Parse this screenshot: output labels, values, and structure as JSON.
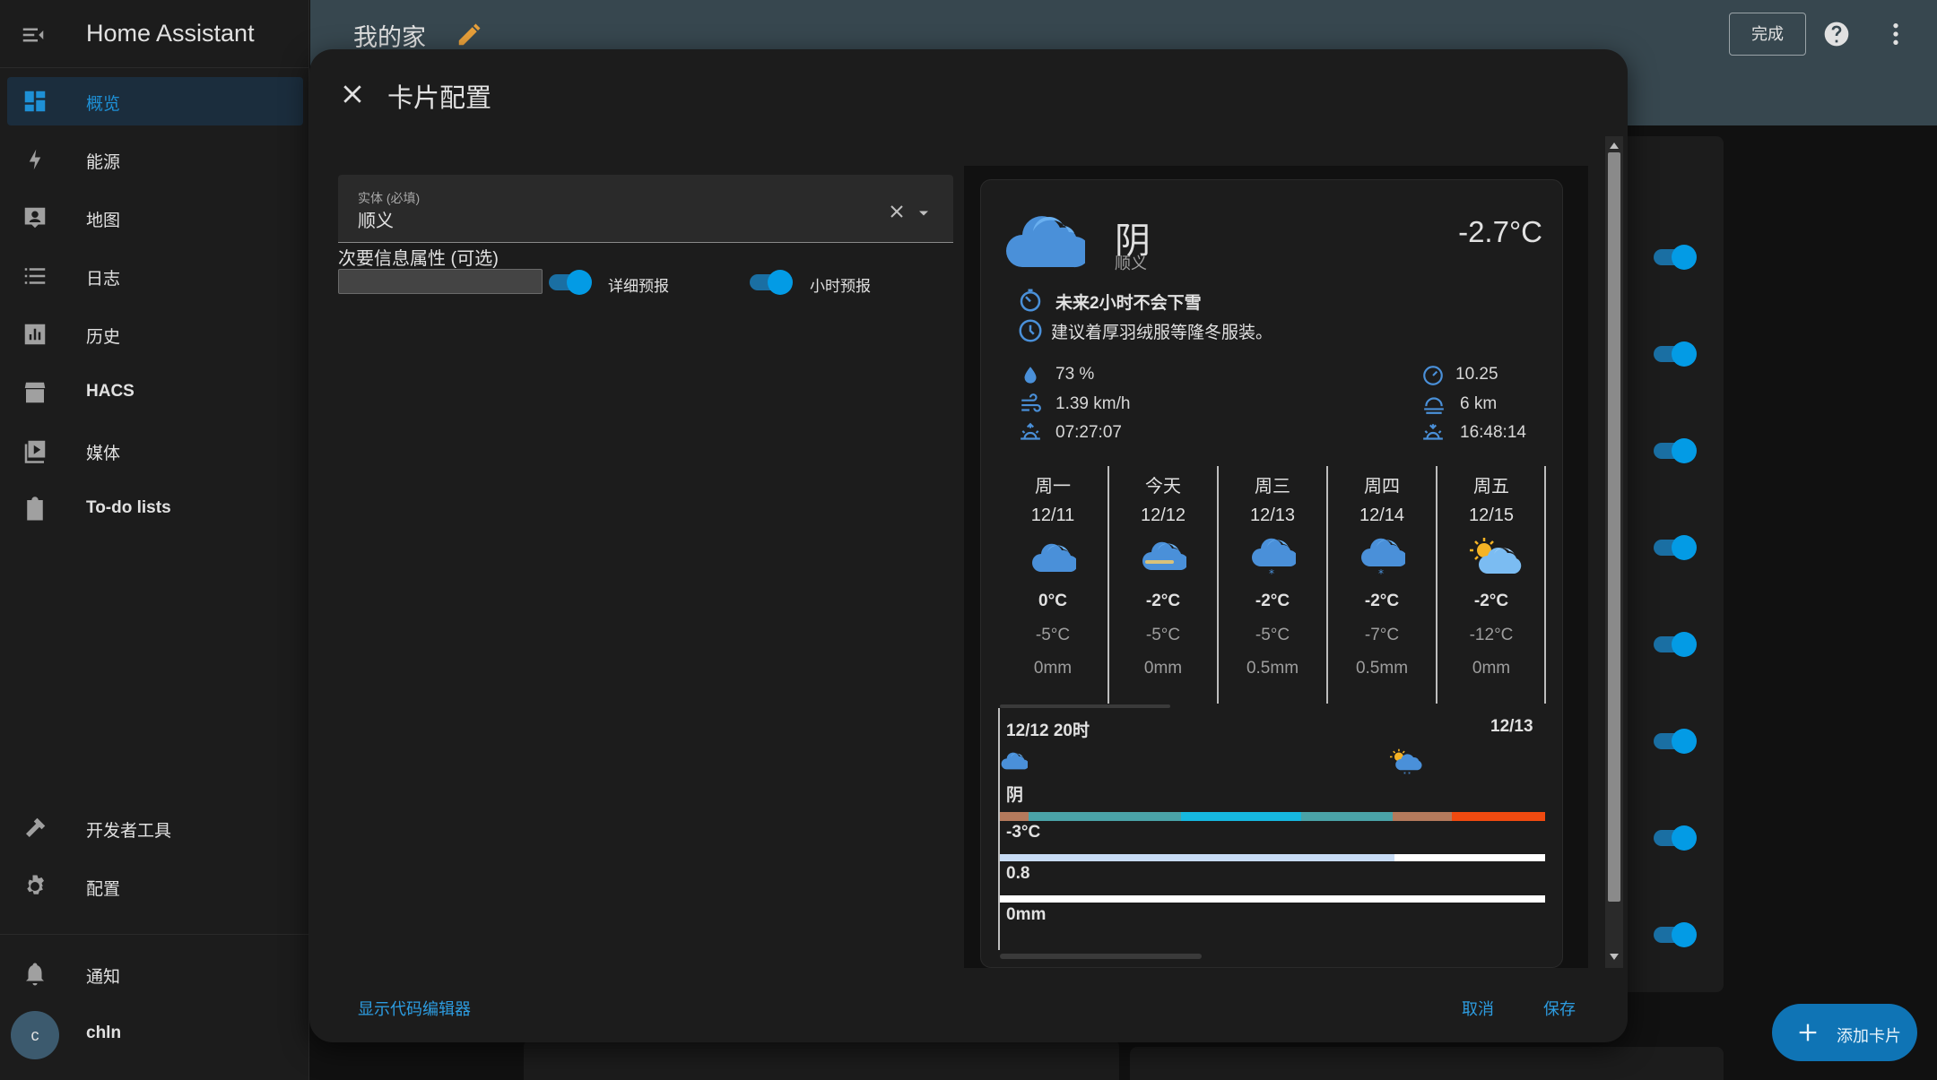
{
  "app": {
    "title": "Home Assistant"
  },
  "sidebar": {
    "items": [
      {
        "label": "概览",
        "icon": "dashboard-icon",
        "active": true
      },
      {
        "label": "能源",
        "icon": "lightning-icon"
      },
      {
        "label": "地图",
        "icon": "map-account-icon"
      },
      {
        "label": "日志",
        "icon": "list-icon"
      },
      {
        "label": "历史",
        "icon": "chart-box-icon"
      },
      {
        "label": "HACS",
        "icon": "hacs-icon"
      },
      {
        "label": "媒体",
        "icon": "play-box-icon"
      },
      {
        "label": "To-do lists",
        "icon": "clipboard-list-icon"
      }
    ],
    "bottom_items": [
      {
        "label": "开发者工具",
        "icon": "hammer-icon"
      },
      {
        "label": "配置",
        "icon": "gear-icon"
      }
    ],
    "notifications_label": "通知",
    "user": {
      "initial": "c",
      "name": "chln"
    }
  },
  "topbar": {
    "title": "我的家",
    "done_label": "完成"
  },
  "fab": {
    "label": "添加卡片"
  },
  "dialog": {
    "title": "卡片配置",
    "entity": {
      "label": "实体 (必填)",
      "value": "顺义"
    },
    "secondary": {
      "label": "次要信息属性 (可选)",
      "value": ""
    },
    "toggles": [
      {
        "label": "详细预报",
        "on": true
      },
      {
        "label": "小时预报",
        "on": true
      }
    ],
    "show_code_editor": "显示代码编辑器",
    "cancel": "取消",
    "save": "保存"
  },
  "weather": {
    "condition": "阴",
    "location": "顺义",
    "temperature": "-2.7°C",
    "alert": "未来2小时不会下雪",
    "advice": "建议着厚羽绒服等隆冬服装。",
    "attributes_left": [
      {
        "icon": "humidity-icon",
        "value": "73 %"
      },
      {
        "icon": "wind-icon",
        "value": "1.39 km/h"
      },
      {
        "icon": "sunrise-icon",
        "value": "07:27:07"
      }
    ],
    "attributes_right": [
      {
        "icon": "gauge-icon",
        "value": "10.25"
      },
      {
        "icon": "visibility-icon",
        "value": "6 km"
      },
      {
        "icon": "sunset-icon",
        "value": "16:48:14"
      }
    ],
    "forecast": [
      {
        "day": "周一",
        "date": "12/11",
        "icon": "cloudy-icon",
        "high": "0°C",
        "low": "-5°C",
        "rain": "0mm"
      },
      {
        "day": "今天",
        "date": "12/12",
        "icon": "fog-cloud-icon",
        "high": "-2°C",
        "low": "-5°C",
        "rain": "0mm"
      },
      {
        "day": "周三",
        "date": "12/13",
        "icon": "snow-cloud-icon",
        "high": "-2°C",
        "low": "-5°C",
        "rain": "0.5mm"
      },
      {
        "day": "周四",
        "date": "12/14",
        "icon": "snow-cloud-icon",
        "high": "-2°C",
        "low": "-7°C",
        "rain": "0.5mm"
      },
      {
        "day": "周五",
        "date": "12/15",
        "icon": "partly-sunny-icon",
        "high": "-2°C",
        "low": "-12°C",
        "rain": "0mm"
      }
    ],
    "hourly": {
      "time_start": "12/12 20时",
      "time_next": "12/13",
      "condition": "阴",
      "temp": "-3°C",
      "pop": "0.8",
      "rain": "0mm"
    }
  },
  "colors": {
    "accent": "#039be5",
    "link": "#2d9ce0",
    "topbar": "#37474f",
    "sidebar": "#1c1c1c",
    "weather_icon": "#4a90d9"
  }
}
